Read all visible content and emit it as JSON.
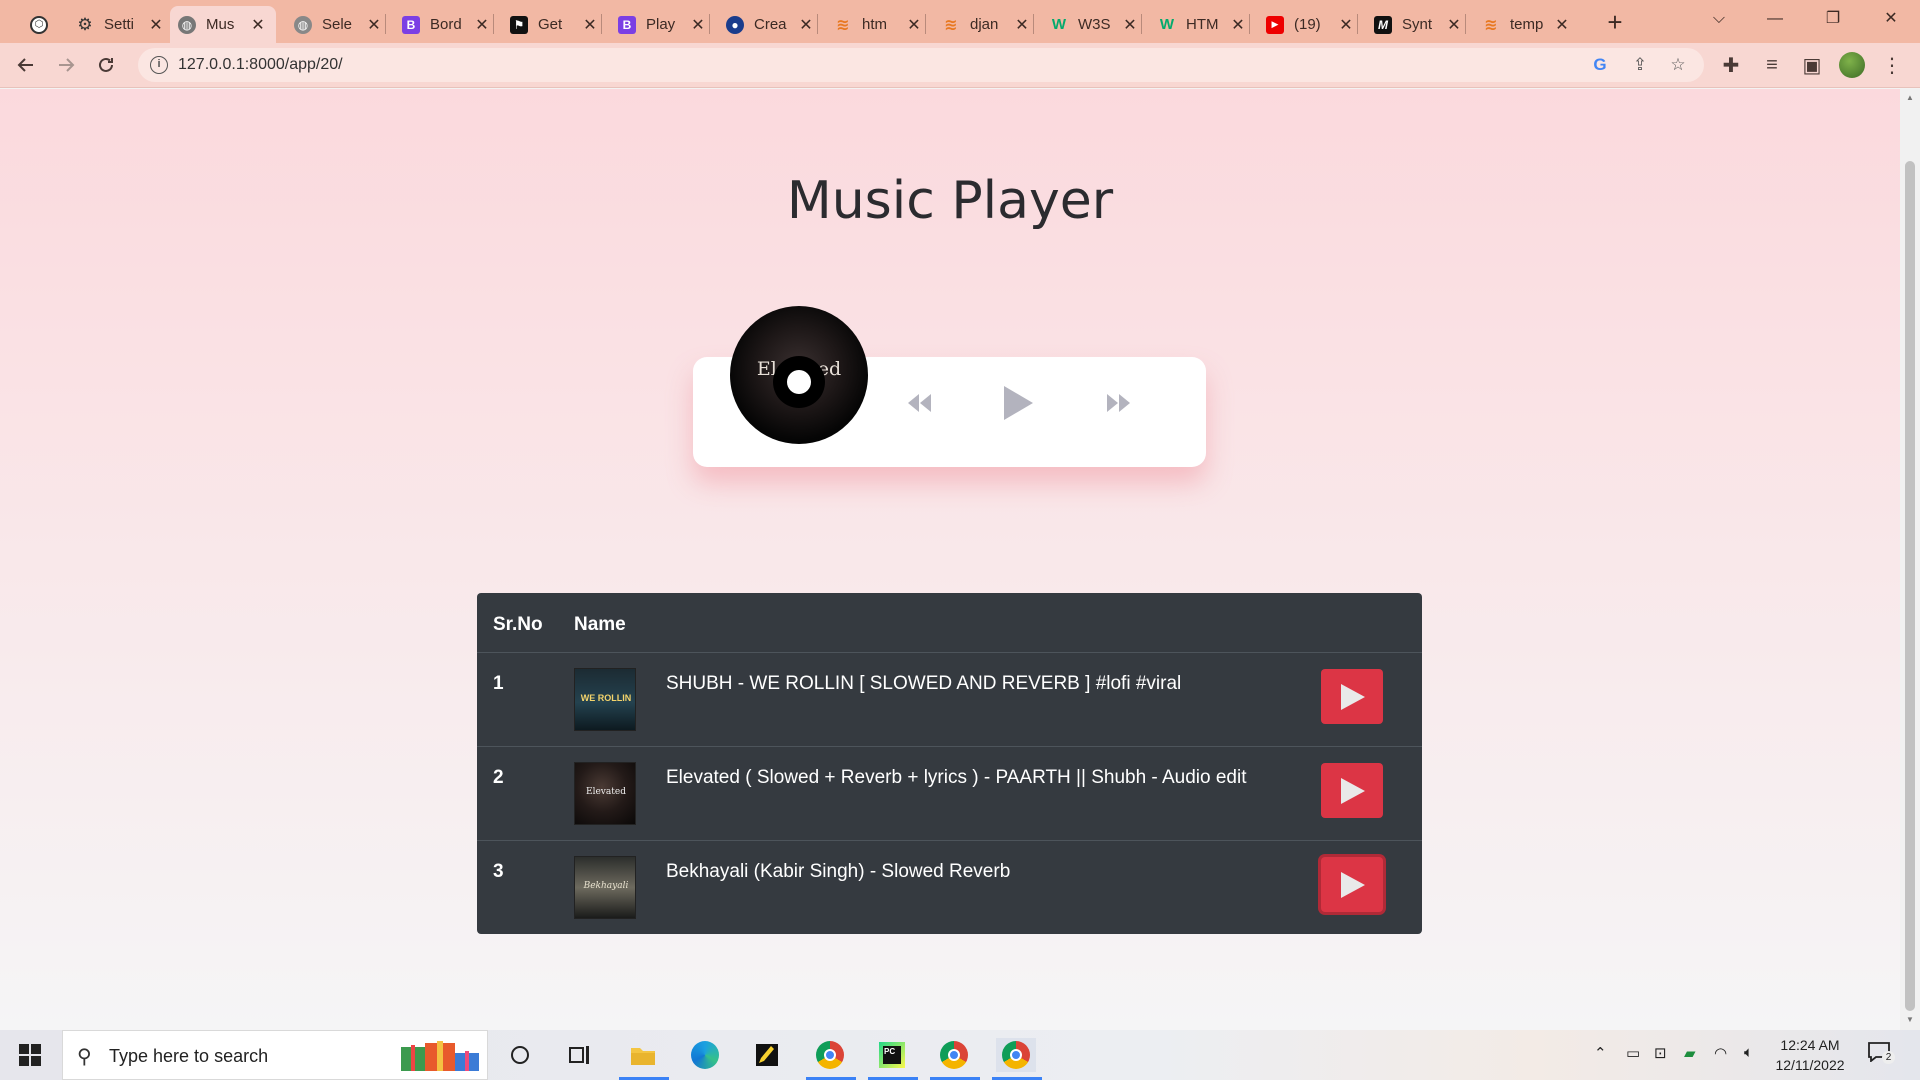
{
  "browser": {
    "tabs": [
      {
        "label": "Setti",
        "icon": "gear-icon"
      },
      {
        "label": "Mus",
        "icon": "globe-icon",
        "active": true
      },
      {
        "label": "Sele",
        "icon": "globe-icon"
      },
      {
        "label": "Bord",
        "icon": "bootstrap-icon"
      },
      {
        "label": "Get",
        "icon": "flag-icon"
      },
      {
        "label": "Play",
        "icon": "bootstrap-icon"
      },
      {
        "label": "Crea",
        "icon": "person-icon"
      },
      {
        "label": "htm",
        "icon": "stack-icon"
      },
      {
        "label": "djan",
        "icon": "stack-icon"
      },
      {
        "label": "W3S",
        "icon": "w3-icon"
      },
      {
        "label": "HTM",
        "icon": "w3-icon"
      },
      {
        "label": "(19)",
        "icon": "youtube-icon"
      },
      {
        "label": "Synt",
        "icon": "medium-icon"
      },
      {
        "label": "temp",
        "icon": "stack-icon"
      }
    ],
    "url": "127.0.0.1:8000/app/20/"
  },
  "page": {
    "title": "Music Player",
    "now_playing_disc_text": "Elevated",
    "table": {
      "headers": {
        "sr": "Sr.No",
        "name": "Name"
      },
      "rows": [
        {
          "sr": "1",
          "name": "SHUBH - WE ROLLIN [ SLOWED AND REVERB ] #lofi #viral",
          "thumb_text": "WE ROLLIN"
        },
        {
          "sr": "2",
          "name": "Elevated ( Slowed + Reverb + lyrics ) - PAARTH || Shubh - Audio edit",
          "thumb_text": "Elevated"
        },
        {
          "sr": "3",
          "name": "Bekhayali (Kabir Singh) - Slowed Reverb",
          "thumb_text": "Bekhayali"
        }
      ]
    },
    "colors": {
      "accent": "#dc3545",
      "table_bg": "#353a40",
      "control": "#b3b3be"
    }
  },
  "taskbar": {
    "search_placeholder": "Type here to search",
    "time": "12:24 AM",
    "date": "12/11/2022",
    "notification_count": "2"
  }
}
